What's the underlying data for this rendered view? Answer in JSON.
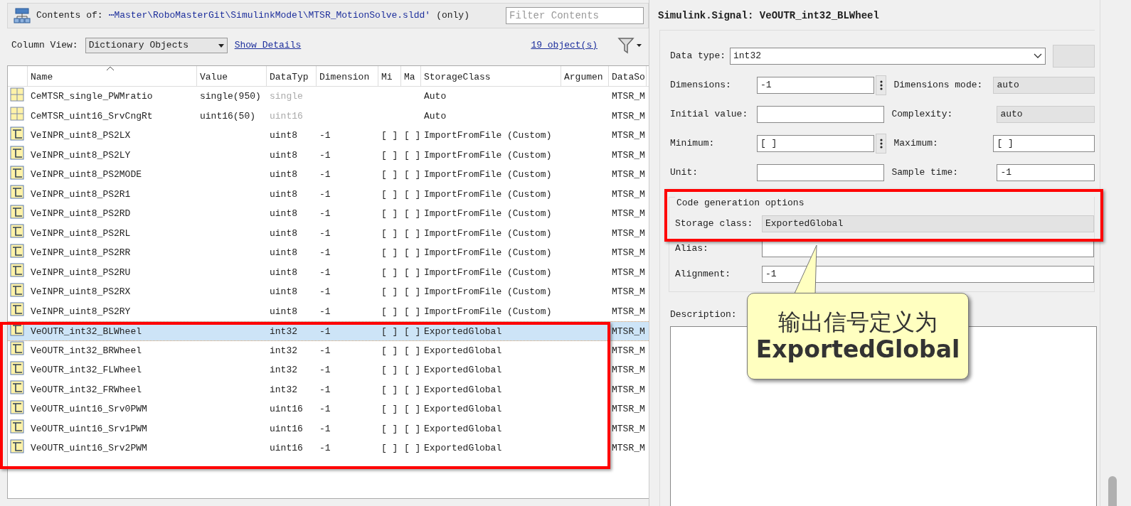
{
  "header": {
    "label": "Contents of:",
    "path": "⋯Master\\RoboMasterGit\\SimulinkModel\\MTSR_MotionSolve.sldd'",
    "suffix": "(only)",
    "filter_placeholder": "Filter Contents"
  },
  "toolbar": {
    "column_view_label": "Column View:",
    "column_view": "Dictionary Objects",
    "show_details": "Show Details",
    "object_count": "19 object(s)"
  },
  "table": {
    "columns": [
      "Name",
      "Value",
      "DataTyp",
      "Dimension",
      "Mi",
      "Ma",
      "StorageClass",
      "Argumen",
      "DataSo"
    ],
    "rows": [
      {
        "kind": "constant",
        "name": "CeMTSR_single_PWMratio",
        "value": "single(950)",
        "datatype": "single",
        "storage_class": "Auto",
        "data_source": "MTSR_M",
        "selected": false
      },
      {
        "kind": "constant",
        "name": "CeMTSR_uint16_SrvCngRt",
        "value": "uint16(50)",
        "datatype": "uint16",
        "storage_class": "Auto",
        "data_source": "MTSR_M",
        "selected": false
      },
      {
        "kind": "signal",
        "name": "VeINPR_uint8_PS2LX",
        "datatype": "uint8",
        "dimensions": "-1",
        "min": "[ ]",
        "max": "[ ]",
        "storage_class": "ImportFromFile (Custom)",
        "data_source": "MTSR_M",
        "selected": false
      },
      {
        "kind": "signal",
        "name": "VeINPR_uint8_PS2LY",
        "datatype": "uint8",
        "dimensions": "-1",
        "min": "[ ]",
        "max": "[ ]",
        "storage_class": "ImportFromFile (Custom)",
        "data_source": "MTSR_M",
        "selected": false
      },
      {
        "kind": "signal",
        "name": "VeINPR_uint8_PS2MODE",
        "datatype": "uint8",
        "dimensions": "-1",
        "min": "[ ]",
        "max": "[ ]",
        "storage_class": "ImportFromFile (Custom)",
        "data_source": "MTSR_M",
        "selected": false
      },
      {
        "kind": "signal",
        "name": "VeINPR_uint8_PS2R1",
        "datatype": "uint8",
        "dimensions": "-1",
        "min": "[ ]",
        "max": "[ ]",
        "storage_class": "ImportFromFile (Custom)",
        "data_source": "MTSR_M",
        "selected": false
      },
      {
        "kind": "signal",
        "name": "VeINPR_uint8_PS2RD",
        "datatype": "uint8",
        "dimensions": "-1",
        "min": "[ ]",
        "max": "[ ]",
        "storage_class": "ImportFromFile (Custom)",
        "data_source": "MTSR_M",
        "selected": false
      },
      {
        "kind": "signal",
        "name": "VeINPR_uint8_PS2RL",
        "datatype": "uint8",
        "dimensions": "-1",
        "min": "[ ]",
        "max": "[ ]",
        "storage_class": "ImportFromFile (Custom)",
        "data_source": "MTSR_M",
        "selected": false
      },
      {
        "kind": "signal",
        "name": "VeINPR_uint8_PS2RR",
        "datatype": "uint8",
        "dimensions": "-1",
        "min": "[ ]",
        "max": "[ ]",
        "storage_class": "ImportFromFile (Custom)",
        "data_source": "MTSR_M",
        "selected": false
      },
      {
        "kind": "signal",
        "name": "VeINPR_uint8_PS2RU",
        "datatype": "uint8",
        "dimensions": "-1",
        "min": "[ ]",
        "max": "[ ]",
        "storage_class": "ImportFromFile (Custom)",
        "data_source": "MTSR_M",
        "selected": false
      },
      {
        "kind": "signal",
        "name": "VeINPR_uint8_PS2RX",
        "datatype": "uint8",
        "dimensions": "-1",
        "min": "[ ]",
        "max": "[ ]",
        "storage_class": "ImportFromFile (Custom)",
        "data_source": "MTSR_M",
        "selected": false
      },
      {
        "kind": "signal",
        "name": "VeINPR_uint8_PS2RY",
        "datatype": "uint8",
        "dimensions": "-1",
        "min": "[ ]",
        "max": "[ ]",
        "storage_class": "ImportFromFile (Custom)",
        "data_source": "MTSR_M",
        "selected": false
      },
      {
        "kind": "signal",
        "name": "VeOUTR_int32_BLWheel",
        "datatype": "int32",
        "dimensions": "-1",
        "min": "[ ]",
        "max": "[ ]",
        "storage_class": "ExportedGlobal",
        "data_source": "MTSR_M",
        "selected": true
      },
      {
        "kind": "signal",
        "name": "VeOUTR_int32_BRWheel",
        "datatype": "int32",
        "dimensions": "-1",
        "min": "[ ]",
        "max": "[ ]",
        "storage_class": "ExportedGlobal",
        "data_source": "MTSR_M",
        "selected": false
      },
      {
        "kind": "signal",
        "name": "VeOUTR_int32_FLWheel",
        "datatype": "int32",
        "dimensions": "-1",
        "min": "[ ]",
        "max": "[ ]",
        "storage_class": "ExportedGlobal",
        "data_source": "MTSR_M",
        "selected": false
      },
      {
        "kind": "signal",
        "name": "VeOUTR_int32_FRWheel",
        "datatype": "int32",
        "dimensions": "-1",
        "min": "[ ]",
        "max": "[ ]",
        "storage_class": "ExportedGlobal",
        "data_source": "MTSR_M",
        "selected": false
      },
      {
        "kind": "signal",
        "name": "VeOUTR_uint16_Srv0PWM",
        "datatype": "uint16",
        "dimensions": "-1",
        "min": "[ ]",
        "max": "[ ]",
        "storage_class": "ExportedGlobal",
        "data_source": "MTSR_M",
        "selected": false
      },
      {
        "kind": "signal",
        "name": "VeOUTR_uint16_Srv1PWM",
        "datatype": "uint16",
        "dimensions": "-1",
        "min": "[ ]",
        "max": "[ ]",
        "storage_class": "ExportedGlobal",
        "data_source": "MTSR_M",
        "selected": false
      },
      {
        "kind": "signal",
        "name": "VeOUTR_uint16_Srv2PWM",
        "datatype": "uint16",
        "dimensions": "-1",
        "min": "[ ]",
        "max": "[ ]",
        "storage_class": "ExportedGlobal",
        "data_source": "MTSR_M",
        "selected": false
      }
    ]
  },
  "details": {
    "title": "Simulink.Signal: VeOUTR_int32_BLWheel",
    "data_type": {
      "label": "Data type:",
      "value": "int32"
    },
    "dimensions": {
      "label": "Dimensions:",
      "value": "-1"
    },
    "dimensions_mode": {
      "label": "Dimensions mode:",
      "value": "auto"
    },
    "initial_value": {
      "label": "Initial value:"
    },
    "complexity": {
      "label": "Complexity:",
      "value": "auto"
    },
    "minimum": {
      "label": "Minimum:",
      "value": "[ ]"
    },
    "maximum": {
      "label": "Maximum:",
      "value": "[ ]"
    },
    "unit": {
      "label": "Unit:"
    },
    "sample_time": {
      "label": "Sample time:",
      "value": "-1"
    },
    "code_generation": {
      "legend": "Code generation options",
      "storage_class": {
        "label": "Storage class:",
        "value": "ExportedGlobal"
      },
      "alias": {
        "label": "Alias:"
      },
      "alignment": {
        "label": "Alignment:",
        "value": "-1"
      }
    },
    "description": {
      "label": "Description:"
    }
  },
  "callout": {
    "lines": [
      "输出信号定义为",
      "ExportedGlobal"
    ]
  }
}
